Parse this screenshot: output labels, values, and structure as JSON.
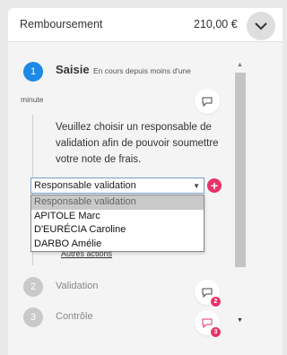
{
  "header": {
    "title": "Remboursement",
    "amount": "210,00 €",
    "toggle_icon": "chevron-down-icon"
  },
  "step1": {
    "number": "1",
    "title": "Saisie",
    "status_line1": "En cours depuis moins d'une",
    "status_line2": "minute",
    "color": "#1e88e5"
  },
  "description": "Veuillez choisir un responsable de validation afin de pouvoir soumettre votre note de frais.",
  "select": {
    "value": "Responsable validation",
    "options": [
      "Responsable validation",
      "APITOLE Marc",
      "D'EURÉCIA Caroline",
      "DARBO Amélie"
    ]
  },
  "autres_actions": "Autres actions",
  "step2": {
    "number": "2",
    "label": "Validation",
    "comment_count": "2"
  },
  "step3": {
    "number": "3",
    "label": "Contrôle",
    "comment_count": "3"
  },
  "accent_color": "#e8336a"
}
